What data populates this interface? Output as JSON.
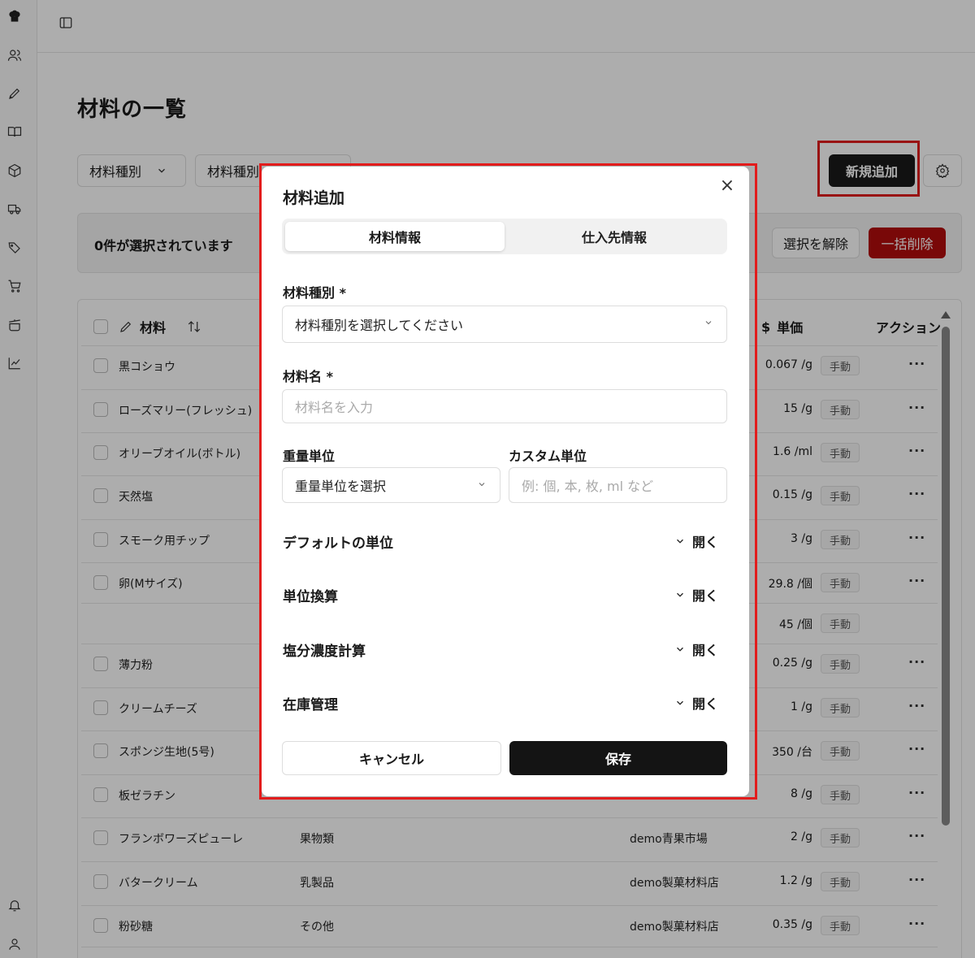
{
  "page": {
    "title": "材料の一覧",
    "filters": [
      "材料種別",
      "材料種別"
    ],
    "new_button": "新規追加",
    "selection_text": "0件が選択されています",
    "clear_button": "選択を解除",
    "bulk_delete_button": "一括削除"
  },
  "table": {
    "headers": {
      "material": "材料",
      "unit_price": "単価",
      "actions": "アクション"
    },
    "price_icon": "$",
    "manual_label": "手動",
    "rows": [
      {
        "name": "黒コショウ",
        "category": "",
        "supplier": "",
        "price": "0.067 /g"
      },
      {
        "name": "ローズマリー(フレッシュ)",
        "category": "",
        "supplier": "",
        "price": "15 /g"
      },
      {
        "name": "オリーブオイル(ボトル)",
        "category": "",
        "supplier": "",
        "price": "1.6 /ml"
      },
      {
        "name": "天然塩",
        "category": "",
        "supplier": "",
        "price": "0.15 /g"
      },
      {
        "name": "スモーク用チップ",
        "category": "",
        "supplier": "",
        "price": "3 /g"
      },
      {
        "name": "卵(Mサイズ)",
        "category": "",
        "supplier": "",
        "price": "29.8 /個"
      },
      {
        "name": "",
        "category": "",
        "supplier": "",
        "price": "45 /個"
      },
      {
        "name": "薄力粉",
        "category": "",
        "supplier": "",
        "price": "0.25 /g"
      },
      {
        "name": "クリームチーズ",
        "category": "",
        "supplier": "",
        "price": "1 /g"
      },
      {
        "name": "スポンジ生地(5号)",
        "category": "",
        "supplier": "",
        "price": "350 /台"
      },
      {
        "name": "板ゼラチン",
        "category": "",
        "supplier": "",
        "price": "8 /g"
      },
      {
        "name": "フランボワーズピューレ",
        "category": "果物類",
        "supplier": "demo青果市場",
        "price": "2 /g"
      },
      {
        "name": "バタークリーム",
        "category": "乳製品",
        "supplier": "demo製菓材料店",
        "price": "1.2 /g"
      },
      {
        "name": "粉砂糖",
        "category": "その他",
        "supplier": "demo製菓材料店",
        "price": "0.35 /g"
      }
    ]
  },
  "modal": {
    "title": "材料追加",
    "tabs": [
      "材料情報",
      "仕入先情報"
    ],
    "category_label": "材料種別 *",
    "category_placeholder": "材料種別を選択してください",
    "name_label": "材料名 *",
    "name_placeholder": "材料名を入力",
    "weight_unit_label": "重量単位",
    "weight_unit_placeholder": "重量単位を選択",
    "custom_unit_label": "カスタム単位",
    "custom_unit_placeholder": "例: 個, 本, 枚, ml など",
    "sections": [
      "デフォルトの単位",
      "単位換算",
      "塩分濃度計算",
      "在庫管理"
    ],
    "open_label": "開く",
    "cancel_button": "キャンセル",
    "save_button": "保存"
  }
}
